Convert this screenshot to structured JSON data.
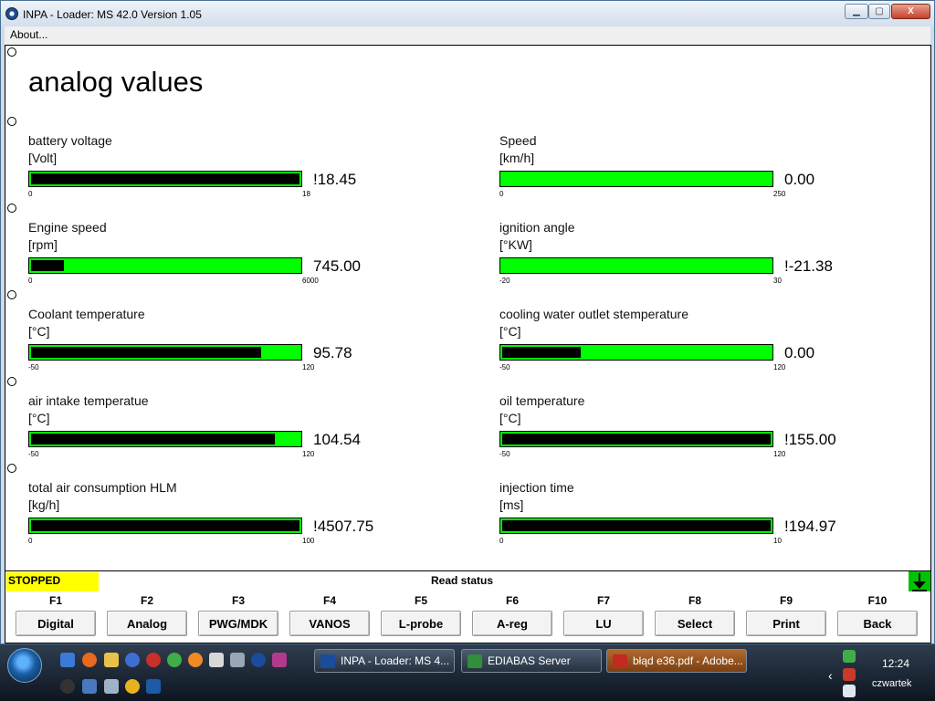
{
  "window": {
    "title": "INPA - Loader:  MS 42.0 Version 1.05",
    "controls": {
      "minimize": "▁",
      "maximize": "▢",
      "close": "X"
    }
  },
  "menu": {
    "about": "About..."
  },
  "page": {
    "title": "analog values"
  },
  "gauges": [
    {
      "label": "battery voltage",
      "unit": "[Volt]",
      "min": "0",
      "max": "18",
      "value": "!18.45",
      "fill": 1.0
    },
    {
      "label": "Speed",
      "unit": "[km/h]",
      "min": "0",
      "max": "250",
      "value": "0.00",
      "fill": 0.0
    },
    {
      "label": "Engine speed",
      "unit": "[rpm]",
      "min": "0",
      "max": "6000",
      "value": "745.00",
      "fill": 0.124
    },
    {
      "label": "ignition angle",
      "unit": "[°KW]",
      "min": "-20",
      "max": "30",
      "value": "!-21.38",
      "fill": 0.0
    },
    {
      "label": "Coolant temperature",
      "unit": "[°C]",
      "min": "-50",
      "max": "120",
      "value": "95.78",
      "fill": 0.857
    },
    {
      "label": "cooling water outlet stemperature",
      "unit": "[°C]",
      "min": "-50",
      "max": "120",
      "value": "0.00",
      "fill": 0.294
    },
    {
      "label": "air intake temperatue",
      "unit": "[°C]",
      "min": "-50",
      "max": "120",
      "value": "104.54",
      "fill": 0.909
    },
    {
      "label": "oil temperature",
      "unit": "[°C]",
      "min": "-50",
      "max": "120",
      "value": "!155.00",
      "fill": 1.0
    },
    {
      "label": "total air consumption HLM",
      "unit": "[kg/h]",
      "min": "0",
      "max": "100",
      "value": "!4507.75",
      "fill": 1.0
    },
    {
      "label": "injection time",
      "unit": "[ms]",
      "min": "0",
      "max": "10",
      "value": "!194.97",
      "fill": 1.0
    }
  ],
  "status": {
    "state": "STOPPED",
    "text": "Read status"
  },
  "function_keys": [
    {
      "key": "F1",
      "label": "Digital"
    },
    {
      "key": "F2",
      "label": "Analog"
    },
    {
      "key": "F3",
      "label": "PWG/MDK"
    },
    {
      "key": "F4",
      "label": "VANOS"
    },
    {
      "key": "F5",
      "label": "L-probe"
    },
    {
      "key": "F6",
      "label": "A-reg"
    },
    {
      "key": "F7",
      "label": "LU"
    },
    {
      "key": "F8",
      "label": "Select"
    },
    {
      "key": "F9",
      "label": "Print"
    },
    {
      "key": "F10",
      "label": "Back"
    }
  ],
  "taskbar": {
    "tasks": [
      {
        "label": "INPA - Loader:  MS 4...",
        "icon": "bmw-icon"
      },
      {
        "label": "EDIABAS Server",
        "icon": "ediabas-icon"
      },
      {
        "label": "błąd e36.pdf - Adobe...",
        "icon": "pdf-icon"
      }
    ],
    "clock": "12:24",
    "day": "czwartek"
  },
  "colors": {
    "bar_bg": "#00ff00",
    "bar_fill": "#000000",
    "status_badge": "#ffff00",
    "arrow": "#00c400"
  }
}
